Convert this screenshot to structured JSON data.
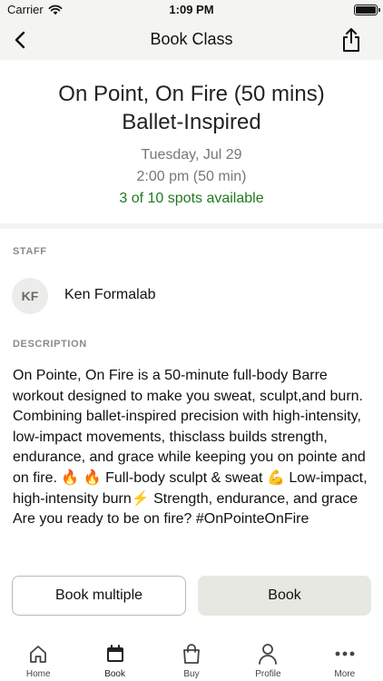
{
  "status_bar": {
    "carrier": "Carrier",
    "time": "1:09 PM"
  },
  "nav": {
    "title": "Book Class",
    "back_icon": "chevron-left-icon",
    "share_icon": "share-icon"
  },
  "class": {
    "title_line1": "On Point, On Fire (50 mins)",
    "title_line2": "Ballet-Inspired",
    "date": "Tuesday, Jul 29",
    "time": "2:00 pm (50 min)",
    "spots": "3 of 10 spots available",
    "spots_color": "#1f7a1f"
  },
  "staff": {
    "label": "STAFF",
    "initials": "KF",
    "name": "Ken Formalab"
  },
  "description": {
    "label": "DESCRIPTION",
    "text": "On Pointe, On Fire is a 50-minute full-body Barre workout designed to make you sweat, sculpt,and burn. Combining ballet-inspired precision with high-intensity, low-impact movements, thisclass builds strength, endurance, and grace while keeping you on pointe and on fire. 🔥 🔥 Full-body sculpt & sweat 💪 Low-impact, high-intensity burn⚡ Strength, endurance, and grace Are you ready to be on fire? #OnPointeOnFire"
  },
  "actions": {
    "book_multiple": "Book multiple",
    "book": "Book"
  },
  "tabs": [
    {
      "label": "Home",
      "icon": "home-icon"
    },
    {
      "label": "Book",
      "icon": "calendar-icon",
      "active": true
    },
    {
      "label": "Buy",
      "icon": "shopping-bag-icon"
    },
    {
      "label": "Profile",
      "icon": "person-icon"
    },
    {
      "label": "More",
      "icon": "more-dots-icon"
    }
  ]
}
